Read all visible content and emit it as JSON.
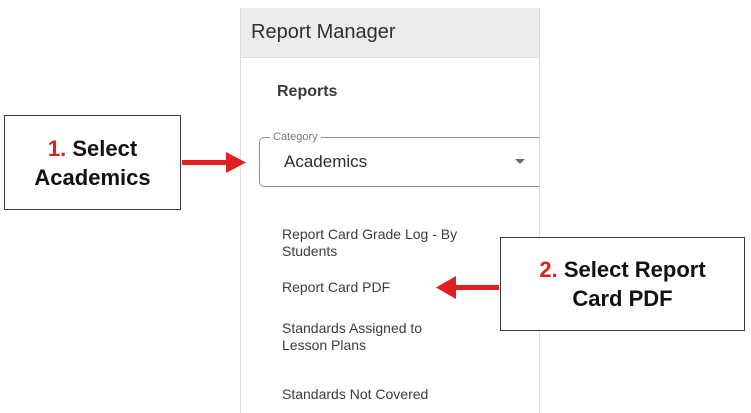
{
  "panel": {
    "title": "Report Manager",
    "section_heading": "Reports",
    "category": {
      "legend": "Category",
      "value": "Academics"
    },
    "report_items": [
      {
        "label": "Report Card Grade Log - By Students"
      },
      {
        "label": "Report Card PDF"
      },
      {
        "label": "Standards Assigned to Lesson Plans"
      },
      {
        "label": "Standards Not Covered"
      }
    ]
  },
  "callouts": {
    "step1": {
      "number": "1.",
      "line1": "Select",
      "line2": "Academics"
    },
    "step2": {
      "number": "2.",
      "line1": "Select Report",
      "line2": "Card PDF"
    }
  },
  "colors": {
    "accent_red": "#e02020",
    "header_bg": "#ececec"
  }
}
